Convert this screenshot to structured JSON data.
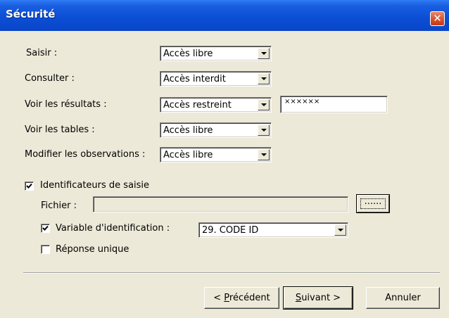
{
  "window": {
    "title": "Sécurité",
    "close_glyph": "✕"
  },
  "access_rows": [
    {
      "label": "Saisir :",
      "value": "Accès libre"
    },
    {
      "label": "Consulter :",
      "value": "Accès interdit"
    },
    {
      "label": "Voir les résultats :",
      "value": "Accès restreint",
      "password": "××××××"
    },
    {
      "label": "Voir les tables :",
      "value": "Accès libre"
    },
    {
      "label": "Modifier les observations :",
      "value": "Accès libre"
    }
  ],
  "identificateurs": {
    "label": "Identificateurs de saisie",
    "checked": true,
    "file_label": "Fichier :",
    "file_value": "",
    "browse_label": "......"
  },
  "variable": {
    "label": "Variable d'identification :",
    "checked": true,
    "value": "29. CODE ID"
  },
  "reponse_unique": {
    "label": "Réponse unique",
    "checked": false
  },
  "buttons": {
    "previous_prefix": "< ",
    "previous_hotkey": "P",
    "previous_rest": "récédent",
    "next_hotkey": "S",
    "next_rest": "uivant >",
    "cancel": "Annuler"
  }
}
